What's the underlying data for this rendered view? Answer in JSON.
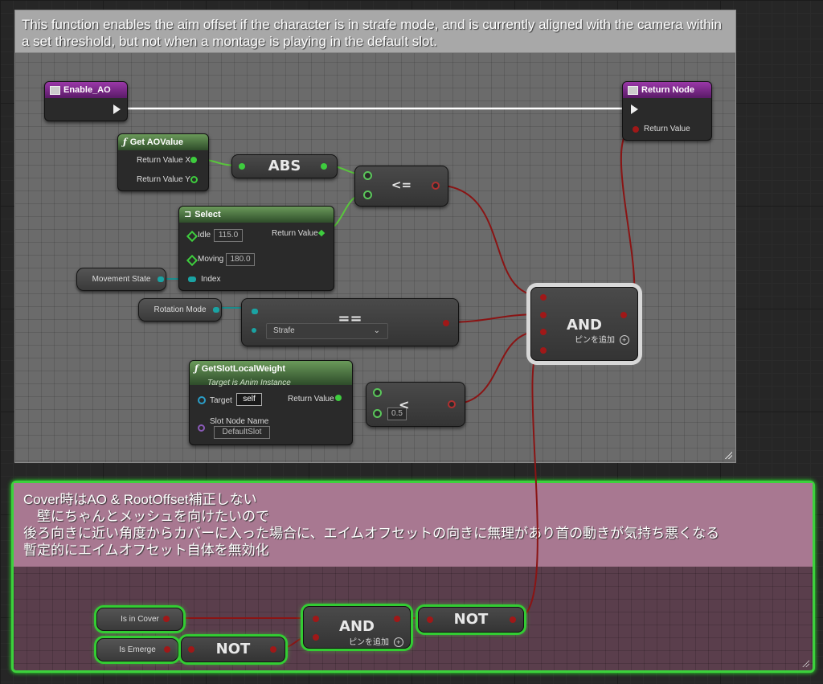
{
  "top_comment": {
    "text": "This function enables the aim offset if the character is in strafe mode, and is currently aligned with the camera within a set threshold, but not when a montage is playing in the default slot."
  },
  "bottom_comment": {
    "lines": [
      "Cover時はAO & RootOffset補正しない",
      "　壁にちゃんとメッシュを向けたいので",
      "後ろ向きに近い角度からカバーに入った場合に、エイムオフセットの向きに無理があり首の動きが気持ち悪くなる",
      "暫定的にエイムオフセット自体を無効化"
    ]
  },
  "nodes": {
    "enable_ao": {
      "title": "Enable_AO"
    },
    "return_node": {
      "title": "Return Node",
      "pin": "Return Value"
    },
    "get_ao_value": {
      "title": "Get AOValue",
      "pin_x": "Return Value X",
      "pin_y": "Return Value Y"
    },
    "abs": {
      "op": "ABS"
    },
    "lte": {
      "op": "<="
    },
    "select": {
      "title": "Select",
      "idle_label": "Idle",
      "idle_value": "115.0",
      "moving_label": "Moving",
      "moving_value": "180.0",
      "index_label": "Index",
      "return_label": "Return Value"
    },
    "movement_state": {
      "label": "Movement State"
    },
    "rotation_mode": {
      "label": "Rotation Mode"
    },
    "equal": {
      "op": "==",
      "dropdown_value": "Strafe"
    },
    "and_main": {
      "op": "AND",
      "add_pin": "ピンを追加"
    },
    "get_slot": {
      "title": "GetSlotLocalWeight",
      "subtitle": "Target is Anim Instance",
      "target_label": "Target",
      "target_value": "self",
      "slot_label": "Slot Node Name",
      "slot_value": "DefaultSlot",
      "return_label": "Return Value"
    },
    "lt": {
      "op": "<",
      "value": "0.5"
    },
    "is_in_cover": {
      "label": "Is in Cover"
    },
    "is_emerge": {
      "label": "Is Emerge"
    },
    "not_emerge": {
      "op": "NOT"
    },
    "and_cover": {
      "op": "AND",
      "add_pin": "ピンを追加"
    },
    "not_cover": {
      "op": "NOT"
    }
  },
  "colors": {
    "exec_wire": "#ffffff",
    "bool_wire": "#8a1414",
    "float_wire": "#59c63c",
    "enum_wire": "#1a8c8c",
    "selection_glow": "#33cc33"
  }
}
